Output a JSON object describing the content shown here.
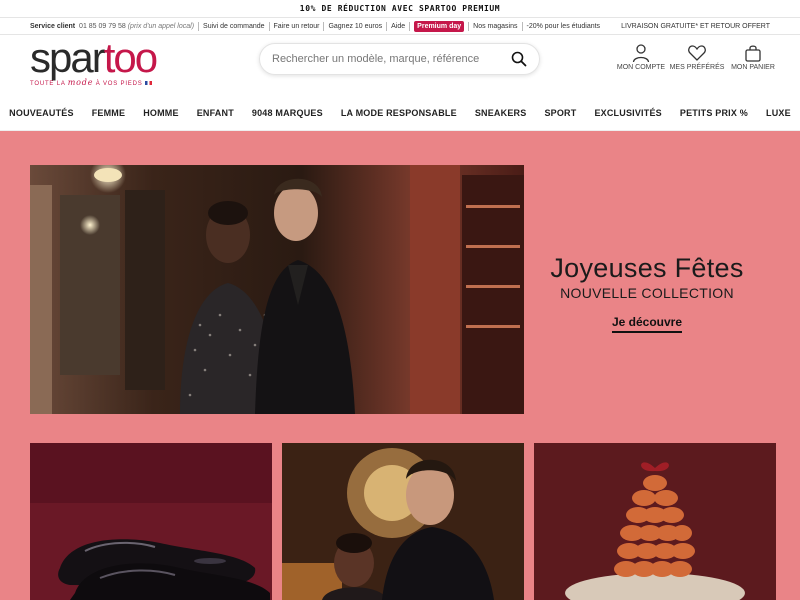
{
  "promo_banner": "10% DE RÉDUCTION AVEC SPARTOO PREMIUM",
  "utility": {
    "service_label": "Service client",
    "service_phone": "01 85 09 79 58",
    "service_note": "(prix d'un appel local)",
    "links": [
      "Suivi de commande",
      "Faire un retour",
      "Gagnez 10 euros",
      "Aide"
    ],
    "premium_badge": "Premium day",
    "links2": [
      "Nos magasins",
      "-20% pour les étudiants"
    ],
    "shipping": "LIVRAISON GRATUITE* ET RETOUR OFFERT"
  },
  "logo": {
    "part1": "spar",
    "part2": "too",
    "tagline_pre": "TOUTE LA",
    "tagline_em": "mode",
    "tagline_post": "À VOS PIEDS"
  },
  "search": {
    "placeholder": "Rechercher un modèle, marque, référence"
  },
  "account": {
    "compte": "MON COMPTE",
    "preferes": "MES PRÉFÉRÉS",
    "panier": "MON PANIER"
  },
  "nav": [
    "NOUVEAUTÉS",
    "FEMME",
    "HOMME",
    "ENFANT",
    "9048 MARQUES",
    "LA MODE RESPONSABLE",
    "SNEAKERS",
    "SPORT",
    "EXCLUSIVITÉS",
    "PETITS PRIX %",
    "LUXE"
  ],
  "hero": {
    "title": "Joyeuses Fêtes",
    "subtitle": "NOUVELLE COLLECTION",
    "cta": "Je découvre"
  },
  "colors": {
    "brand": "#c5174a",
    "page_bg": "#ea8487"
  }
}
